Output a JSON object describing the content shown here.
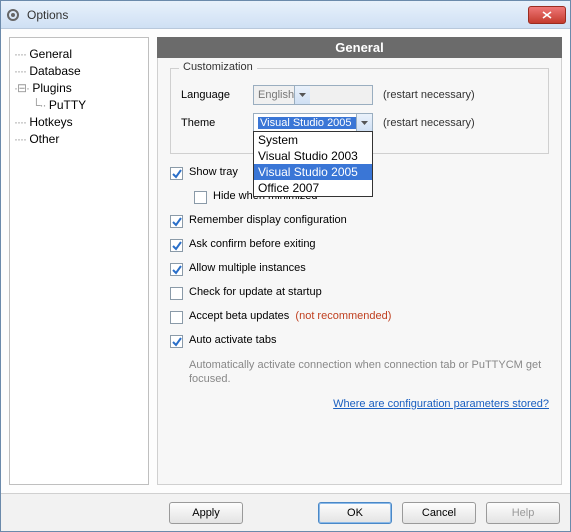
{
  "window": {
    "title": "Options"
  },
  "tree": {
    "items": [
      "General",
      "Database",
      "Plugins",
      "Hotkeys",
      "Other"
    ],
    "plugins_child": "PuTTY"
  },
  "section": {
    "header": "General"
  },
  "customization": {
    "title": "Customization",
    "language_label": "Language",
    "language_value": "English",
    "language_hint": "(restart necessary)",
    "theme_label": "Theme",
    "theme_value": "Visual Studio 2005",
    "theme_hint": "(restart necessary)",
    "theme_options": [
      "System",
      "Visual Studio 2003",
      "Visual Studio 2005",
      "Office 2007"
    ],
    "theme_selected_index": 2
  },
  "checks": {
    "show_tray": {
      "label": "Show tray",
      "checked": true
    },
    "hide_minimized": {
      "label": "Hide when minimized",
      "checked": false
    },
    "remember": {
      "label": "Remember display configuration",
      "checked": true
    },
    "ask_confirm": {
      "label": "Ask confirm before exiting",
      "checked": true
    },
    "allow_multi": {
      "label": "Allow multiple instances",
      "checked": true
    },
    "check_update": {
      "label": "Check for update at startup",
      "checked": false
    },
    "accept_beta": {
      "label": "Accept beta updates",
      "checked": false,
      "warn": "(not recommended)"
    },
    "auto_activate": {
      "label": "Auto activate tabs",
      "checked": true,
      "desc": "Automatically activate connection when connection tab or PuTTYCM get focused."
    }
  },
  "link": "Where are configuration parameters stored?",
  "buttons": {
    "apply": "Apply",
    "ok": "OK",
    "cancel": "Cancel",
    "help": "Help"
  }
}
